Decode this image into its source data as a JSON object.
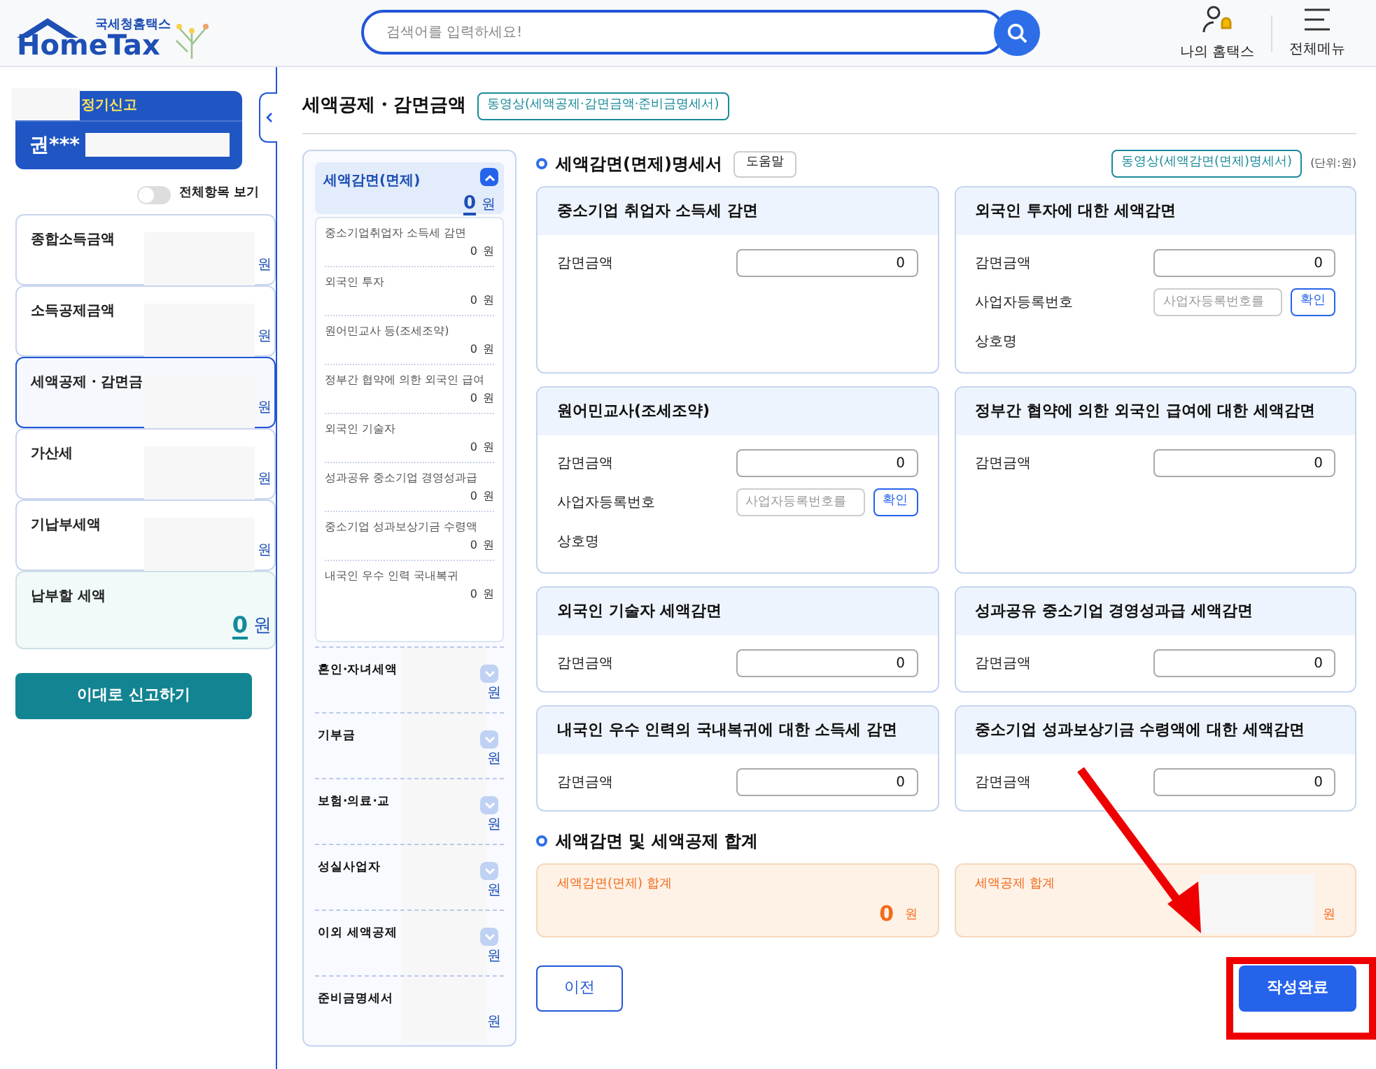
{
  "header": {
    "logo_small": "국세청홈택스",
    "logo_text": "HomeTax",
    "search_placeholder": "검색어를 입력하세요!",
    "links": [
      {
        "kind": "user",
        "label": "나의 홈택스"
      },
      {
        "kind": "menu",
        "label": "전체메뉴"
      }
    ]
  },
  "summary_card": {
    "period_label": "정기신고",
    "name": "권***"
  },
  "toggle": {
    "label": "전체항목 보기",
    "on": false
  },
  "left_nav": [
    {
      "kind": "item",
      "label": "종합소득금액",
      "unit": "원",
      "selected": false
    },
    {
      "kind": "item",
      "label": "소득공제금액",
      "unit": "원",
      "selected": false
    },
    {
      "kind": "item",
      "label": "세액공제・감면금",
      "unit": "원",
      "selected": true
    },
    {
      "kind": "item",
      "label": "가산세",
      "unit": "원",
      "selected": false
    },
    {
      "kind": "item",
      "label": "기납부세액",
      "unit": "원",
      "selected": false
    },
    {
      "kind": "total",
      "label": "납부할 세액",
      "value": "0",
      "unit": "원",
      "selected": false
    }
  ],
  "submit_button": "이대로 신고하기",
  "page_title": "세액공제・감면금액",
  "page_video_button": "동영상(세액공제·감면금액·준비금명세서)",
  "category_nav": [
    {
      "label": "세액감면(면제)",
      "amount": "0",
      "unit": "원",
      "expanded": true,
      "selected": true,
      "children": [
        {
          "label": "중소기업취업자 소득세 감면",
          "amount": "0",
          "unit": "원"
        },
        {
          "label": "외국인 투자",
          "amount": "0",
          "unit": "원"
        },
        {
          "label": "원어민교사 등(조세조약)",
          "amount": "0",
          "unit": "원"
        },
        {
          "label": "정부간 협약에 의한 외국인 급여",
          "amount": "0",
          "unit": "원"
        },
        {
          "label": "외국인 기술자",
          "amount": "0",
          "unit": "원"
        },
        {
          "label": "성과공유 중소기업 경영성과급",
          "amount": "0",
          "unit": "원"
        },
        {
          "label": "중소기업 성과보상기금 수령액",
          "amount": "0",
          "unit": "원"
        },
        {
          "label": "내국인 우수 인력 국내복귀",
          "amount": "0",
          "unit": "원"
        }
      ]
    },
    {
      "label": "혼인·자녀세액",
      "unit": "원",
      "expanded": false,
      "selected": false
    },
    {
      "label": "기부금",
      "unit": "원",
      "expanded": false,
      "selected": false
    },
    {
      "label": "보험·의료·교",
      "unit": "원",
      "expanded": false,
      "selected": false
    },
    {
      "label": "성실사업자",
      "unit": "원",
      "expanded": false,
      "selected": false
    },
    {
      "label": "이외 세액공제",
      "unit": "원",
      "expanded": false,
      "selected": false
    },
    {
      "label": "준비금명세서",
      "unit": "원",
      "selected": false
    }
  ],
  "section_title": "세액감면(면제)명세서",
  "help_button": "도움말",
  "section_video_button": "동영상(세액감면(면제)명세서)",
  "unit_note": "(단위:원)",
  "cards": [
    {
      "title": "중소기업 취업자 소득세 감면",
      "fields": [
        {
          "kind": "amount",
          "label": "감면금액",
          "value": "0"
        }
      ]
    },
    {
      "title": "외국인 투자에 대한 세액감면",
      "fields": [
        {
          "kind": "amount",
          "label": "감면금액",
          "value": "0"
        },
        {
          "kind": "bizno",
          "label": "사업자등록번호",
          "placeholder": "사업자등록번호를",
          "button": "확인"
        },
        {
          "kind": "text",
          "label": "상호명"
        }
      ]
    },
    {
      "title": "원어민교사(조세조약)",
      "fields": [
        {
          "kind": "amount",
          "label": "감면금액",
          "value": "0"
        },
        {
          "kind": "bizno",
          "label": "사업자등록번호",
          "placeholder": "사업자등록번호를",
          "button": "확인"
        },
        {
          "kind": "text",
          "label": "상호명"
        }
      ]
    },
    {
      "title": "정부간 협약에 의한 외국인 급여에 대한 세액감면",
      "fields": [
        {
          "kind": "amount",
          "label": "감면금액",
          "value": "0"
        }
      ]
    },
    {
      "title": "외국인 기술자 세액감면",
      "fields": [
        {
          "kind": "amount",
          "label": "감면금액",
          "value": "0"
        }
      ]
    },
    {
      "title": "성과공유 중소기업 경영성과급 세액감면",
      "fields": [
        {
          "kind": "amount",
          "label": "감면금액",
          "value": "0"
        }
      ]
    },
    {
      "title": "내국인 우수 인력의 국내복귀에 대한 소득세 감면",
      "fields": [
        {
          "kind": "amount",
          "label": "감면금액",
          "value": "0"
        }
      ]
    },
    {
      "title": "중소기업 성과보상기금 수령액에 대한  세액감면",
      "fields": [
        {
          "kind": "amount",
          "label": "감면금액",
          "value": "0"
        }
      ]
    }
  ],
  "totals_title": "세액감면 및 세액공제 합계",
  "totals": [
    {
      "label": "세액감면(면제) 합계",
      "value": "0",
      "unit": "원"
    },
    {
      "label": "세액공제 합계",
      "unit": "원"
    }
  ],
  "prev_button": "이전",
  "complete_button": "작성완료"
}
